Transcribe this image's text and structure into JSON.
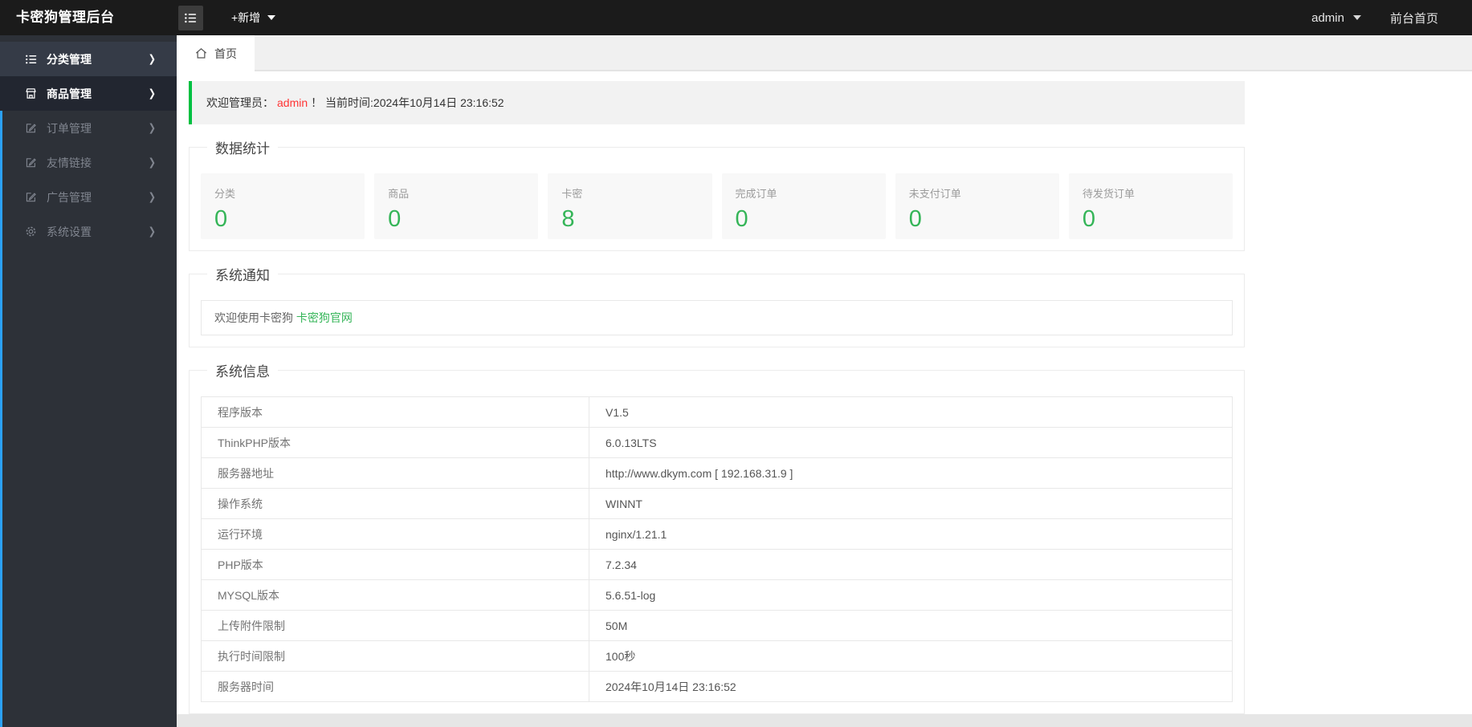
{
  "header": {
    "app_title": "卡密狗管理后台",
    "add_new_label": "+新增",
    "username": "admin",
    "frontend_link": "前台首页"
  },
  "sidebar": {
    "items": [
      {
        "label": "分类管理",
        "icon": "list-icon",
        "state": "active"
      },
      {
        "label": "商品管理",
        "icon": "shop-icon",
        "state": "open"
      },
      {
        "label": "订单管理",
        "icon": "edit-icon",
        "state": "normal"
      },
      {
        "label": "友情链接",
        "icon": "edit-icon",
        "state": "normal"
      },
      {
        "label": "广告管理",
        "icon": "edit-icon",
        "state": "normal"
      },
      {
        "label": "系统设置",
        "icon": "gear-icon",
        "state": "normal"
      }
    ]
  },
  "tabs": {
    "home_label": "首页"
  },
  "welcome": {
    "prefix": "欢迎管理员：",
    "admin_name": "admin",
    "suffix": "！ 当前时间:2024年10月14日 23:16:52"
  },
  "stats": {
    "legend": "数据统计",
    "cards": [
      {
        "label": "分类",
        "value": "0"
      },
      {
        "label": "商品",
        "value": "0"
      },
      {
        "label": "卡密",
        "value": "8"
      },
      {
        "label": "完成订单",
        "value": "0"
      },
      {
        "label": "未支付订单",
        "value": "0"
      },
      {
        "label": "待发货订单",
        "value": "0"
      }
    ]
  },
  "notice": {
    "legend": "系统通知",
    "text": "欢迎使用卡密狗 ",
    "link_label": "卡密狗官网"
  },
  "sysinfo": {
    "legend": "系统信息",
    "rows": [
      {
        "label": "程序版本",
        "value": "V1.5"
      },
      {
        "label": "ThinkPHP版本",
        "value": "6.0.13LTS"
      },
      {
        "label": "服务器地址",
        "value": "http://www.dkym.com [ 192.168.31.9 ]"
      },
      {
        "label": "操作系统",
        "value": "WINNT"
      },
      {
        "label": "运行环境",
        "value": "nginx/1.21.1"
      },
      {
        "label": "PHP版本",
        "value": "7.2.34"
      },
      {
        "label": "MYSQL版本",
        "value": "5.6.51-log"
      },
      {
        "label": "上传附件限制",
        "value": "50M"
      },
      {
        "label": "执行时间限制",
        "value": "100秒"
      },
      {
        "label": "服务器时间",
        "value": "2024年10月14日 23:16:52"
      }
    ]
  },
  "colors": {
    "accent_green": "#35b558",
    "alert_border_green": "#00c041",
    "sidebar_accent_blue": "#2ba1f7",
    "admin_red": "#ff3333"
  }
}
